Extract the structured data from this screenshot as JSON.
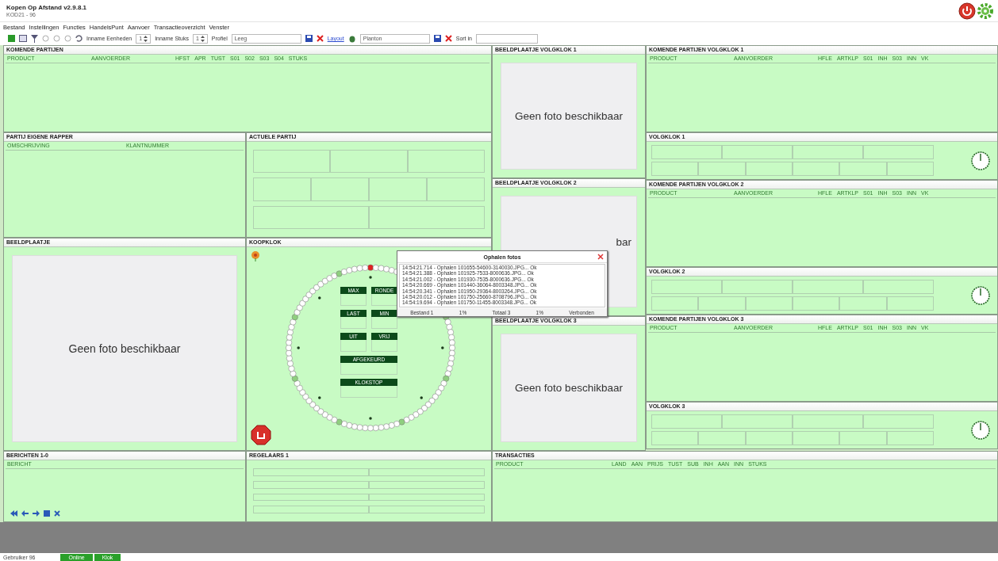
{
  "window": {
    "title": "Kopen Op Afstand v2.9.8.1",
    "subtitle": "KOD21 - 96"
  },
  "menu": [
    "Bestand",
    "Instellingen",
    "Functies",
    "HandelsPunt",
    "Aanvoer",
    "Transactieoverzicht",
    "Venster"
  ],
  "toolbar": {
    "fields": [
      {
        "label": "Inname Eenheden",
        "value": "1"
      },
      {
        "label": "Inname Stuks",
        "value": "1"
      }
    ],
    "profile": {
      "label": "Profiel",
      "value": "Leeg"
    },
    "layout": {
      "label": "Layout",
      "value": "Planton"
    },
    "sort": {
      "label": "Sort in"
    }
  },
  "komende_partijen": {
    "title": "KOMENDE PARTIJEN",
    "columns": [
      "PRODUCT",
      "AANVOERDER",
      "HFST",
      "APR",
      "TUST",
      "S01",
      "S02",
      "S03",
      "S04",
      "STUKS"
    ]
  },
  "partij_eigen": {
    "title": "PARTIJ EIGENE RAPPER",
    "columns": [
      "OMSCHRIJVING",
      "KLANTNUMMER"
    ]
  },
  "actuele_partij": {
    "title": "ACTUELE PARTIJ"
  },
  "beeldplaatje": {
    "title": "BEELDPLAATJE",
    "text": "Geen foto beschikbaar"
  },
  "klok": {
    "title": "KOOPKLOK",
    "buttons": [
      {
        "label": "MAX",
        "wide": false
      },
      {
        "label": "RONDE",
        "wide": false
      },
      {
        "label": "LAST",
        "wide": false
      },
      {
        "label": "MIN",
        "wide": false
      },
      {
        "label": "UIT",
        "wide": false
      },
      {
        "label": "VRIJ",
        "wide": false
      },
      {
        "label": "AFGEKEURD",
        "wide": true
      },
      {
        "label": "KLOKSTOP",
        "wide": true
      }
    ]
  },
  "berichten": {
    "title": "BERICHTEN 1-0",
    "columns": [
      "BERICHT"
    ]
  },
  "regelaars": {
    "title": "REGELAARS 1"
  },
  "transacties": {
    "title": "TRANSACTIES",
    "columns": [
      "PRODUCT",
      "LAND",
      "AAN",
      "PRIJS",
      "TUST",
      "SUB",
      "INH",
      "AAN",
      "INN",
      "STUKS"
    ]
  },
  "volgklokken": [
    {
      "photo_title": "BEELDPLAATJE VOLGKLOK 1",
      "photo_text": "Geen foto beschikbaar",
      "photo_cut": false,
      "parties_title": "KOMENDE PARTIJEN VOLGKLOK 1",
      "columns": [
        "PRODUCT",
        "AANVOERDER",
        "HFLE",
        "ARTKLP",
        "S01",
        "INH",
        "S03",
        "INN",
        "VK"
      ],
      "clock_title": "VOLGKLOK 1"
    },
    {
      "photo_title": "BEELDPLAATJE VOLGKLOK 2",
      "photo_text": "bar",
      "photo_cut": true,
      "parties_title": "KOMENDE PARTIJEN VOLGKLOK 2",
      "columns": [
        "PRODUCT",
        "AANVOERDER",
        "HFLE",
        "ARTKLP",
        "S01",
        "INH",
        "S03",
        "INN",
        "VK"
      ],
      "clock_title": "VOLGKLOK 2"
    },
    {
      "photo_title": "BEELDPLAATJE VOLGKLOK 3",
      "photo_text": "Geen foto beschikbaar",
      "photo_cut": false,
      "parties_title": "KOMENDE PARTIJEN VOLGKLOK 3",
      "columns": [
        "PRODUCT",
        "AANVOERDER",
        "HFLE",
        "ARTKLP",
        "S01",
        "INH",
        "S03",
        "INN",
        "VK"
      ],
      "clock_title": "VOLGKLOK 3"
    }
  ],
  "dialog": {
    "title": "Ophalen fotos",
    "lines": [
      "14:54:21.714 - Ophalen 101655-54600-3140030.JPG... Ok",
      "14:54:21.388 - Ophalen 101925-7533-8000636.JPG... Ok",
      "14:54:21.002 - Ophalen 101930-7535-8000636.JPG... Ok",
      "14:54:20.669 - Ophalen 101440-36064-8003348.JPG... Ok",
      "14:54:20.341 - Ophalen 101950-29364-8003264.JPG... Ok",
      "14:54:20.012 - Ophalen 101750-25660-8708796.JPG... Ok",
      "14:54:19.694 - Ophalen 101750-11455-8003348.JPG... Ok"
    ],
    "footer": [
      "Bestand 1",
      "1%",
      "Totaal 3",
      "1%",
      "Verbonden"
    ]
  },
  "status_bar": {
    "text": "Gebruiker 96",
    "segments": [
      "Online",
      "Klok"
    ]
  }
}
